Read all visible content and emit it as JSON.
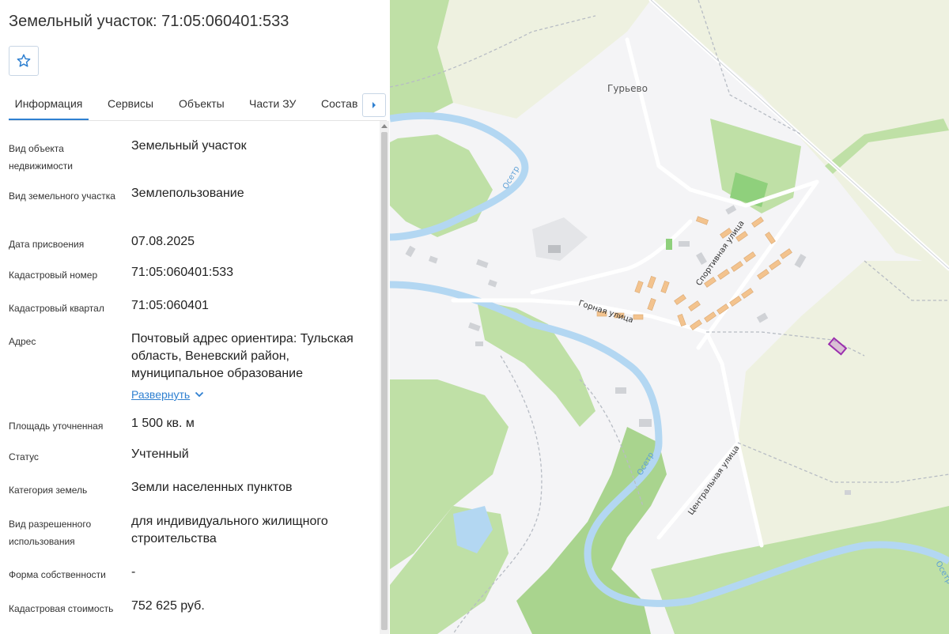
{
  "header": {
    "title": "Земельный участок: 71:05:060401:533"
  },
  "tabs": [
    {
      "label": "Информация",
      "active": true
    },
    {
      "label": "Сервисы",
      "active": false
    },
    {
      "label": "Объекты",
      "active": false
    },
    {
      "label": "Части ЗУ",
      "active": false
    },
    {
      "label": "Состав",
      "active": false
    }
  ],
  "info": {
    "object_type": {
      "label": "Вид объекта недвижимости",
      "value": "Земельный участок"
    },
    "land_type": {
      "label": "Вид земельного участка",
      "value": "Землепользование"
    },
    "assign_date": {
      "label": "Дата присвоения",
      "value": "07.08.2025"
    },
    "cadastral_number": {
      "label": "Кадастровый номер",
      "value": "71:05:060401:533"
    },
    "cadastral_quarter": {
      "label": "Кадастровый квартал",
      "value": "71:05:060401"
    },
    "address": {
      "label": "Адрес",
      "value": "Почтовый адрес ориентира: Тульская область, Веневский район, муниципальное образование",
      "expand_label": "Развернуть"
    },
    "area": {
      "label": "Площадь уточненная",
      "value": "1 500 кв. м"
    },
    "status": {
      "label": "Статус",
      "value": "Учтенный"
    },
    "land_category": {
      "label": "Категория земель",
      "value": "Земли населенных пунктов"
    },
    "permitted_use": {
      "label": "Вид разрешенного использования",
      "value": "для индивидуального жилищного строительства"
    },
    "ownership_form": {
      "label": "Форма собственности",
      "value": "-"
    },
    "cadastral_value": {
      "label": "Кадастровая стоимость",
      "value": "752 625 руб."
    }
  },
  "map": {
    "labels": {
      "village": "Гурьево",
      "river1": "Осетр",
      "river2": "Осетр",
      "river3": "Осетр",
      "street_gornaya": "Горная улица",
      "street_sport": "Спортивная улица",
      "street_central": "Центральная улица"
    },
    "colors": {
      "forest": "#bfe0a6",
      "forest_dark": "#a9d48e",
      "field": "#eef1e0",
      "built": "#f4f4f6",
      "water": "#b3d7f2",
      "house": "#f3c38e",
      "parcel": "#9b2fae"
    }
  }
}
